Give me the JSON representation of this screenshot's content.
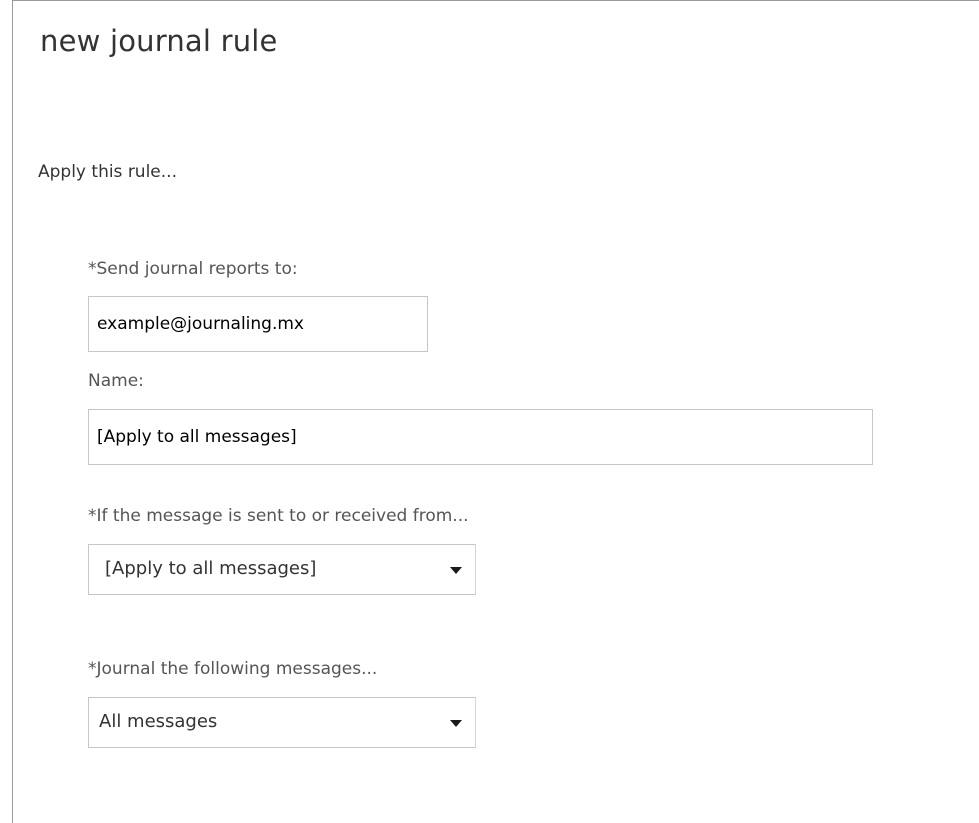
{
  "dialog": {
    "title": "new journal rule",
    "section_label": "Apply this rule..."
  },
  "form": {
    "recipient": {
      "label": "*Send journal reports to:",
      "value": "example@journaling.mx"
    },
    "name": {
      "label": "Name:",
      "value": "[Apply to all messages]"
    },
    "scope": {
      "label": "*If the message is sent to or received from...",
      "selected": "[Apply to all messages]"
    },
    "journal_messages": {
      "label": "*Journal the following messages...",
      "selected": "All messages"
    }
  },
  "icons": {
    "dropdown_arrow": "chevron-down-icon"
  }
}
